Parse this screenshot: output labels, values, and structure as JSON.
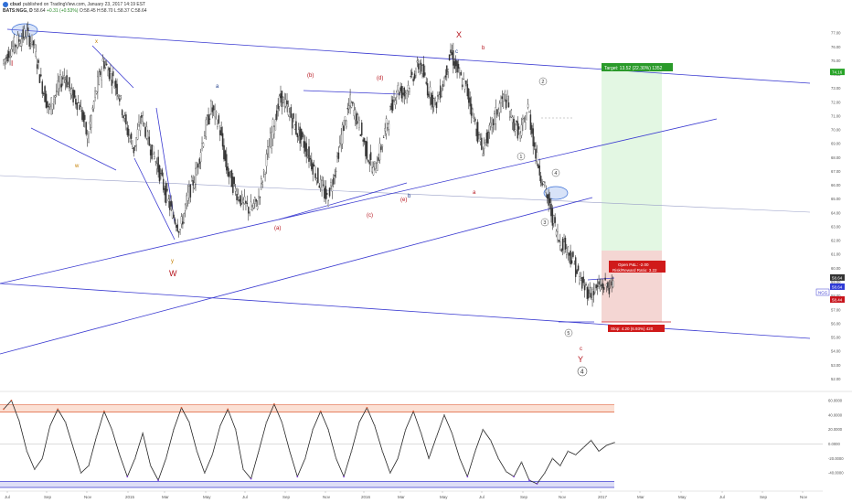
{
  "header": {
    "author": "cbud",
    "published": "published on TradingView.com, January 23, 2017 14:19 EST",
    "symbol": "BATS:NGG, D",
    "open": "58.64",
    "change": "+0.31 (+0.53%)",
    "ohlc_rest": "O:58.45 H:58.70 L:58.37 C:58.64"
  },
  "colors": {
    "candle": "#333333",
    "channel": "#3b3bd1",
    "wave_red": "#b5121b",
    "wave_orange": "#c47f00",
    "wave_blue": "#1f3d8a",
    "target_zone": "#d4f2d4",
    "stop_zone": "#f8d0d0",
    "osc_line": "#222222",
    "osc_upper_band": "#e0603a",
    "osc_lower_band": "#3b3bd1"
  },
  "chart_data": [
    {
      "type": "line",
      "title": "",
      "xlabel": "",
      "ylabel": "",
      "x_ticks": [
        "Jul",
        "Sep",
        "Nov",
        "2015",
        "Mar",
        "May",
        "Jul",
        "Sep",
        "Nov",
        "2016",
        "Mar",
        "May",
        "Jul",
        "Sep",
        "Nov",
        "2017",
        "Mar",
        "May",
        "Jul",
        "Sep",
        "Nov"
      ],
      "y_ticks": [
        "77.00",
        "76.00",
        "75.00",
        "74.00",
        "73.00",
        "72.00",
        "71.00",
        "70.00",
        "69.00",
        "68.00",
        "67.00",
        "66.00",
        "65.00",
        "64.00",
        "63.00",
        "62.00",
        "61.00",
        "60.00",
        "59.00",
        "58.00",
        "57.00",
        "56.00",
        "55.00",
        "54.00",
        "53.00",
        "52.00"
      ],
      "ylim": [
        51.5,
        78
      ],
      "series": [
        {
          "values": [
            [
              0,
              74.8
            ],
            [
              1,
              75.8
            ],
            [
              2,
              76.4
            ],
            [
              3,
              77.0
            ],
            [
              4,
              76.2
            ],
            [
              5,
              73.5
            ],
            [
              6,
              71.4
            ],
            [
              7,
              72.8
            ],
            [
              8,
              74.0
            ],
            [
              9,
              72.5
            ],
            [
              10,
              71.8
            ],
            [
              11,
              69.4
            ],
            [
              12,
              72.5
            ],
            [
              13,
              75.0
            ],
            [
              14,
              74.0
            ],
            [
              15,
              72.8
            ],
            [
              16,
              70.2
            ],
            [
              17,
              68.6
            ],
            [
              18,
              71.0
            ],
            [
              19,
              69.0
            ],
            [
              20,
              67.5
            ],
            [
              21,
              65.6
            ],
            [
              22,
              63.9
            ],
            [
              23,
              62.8
            ],
            [
              24,
              65.2
            ],
            [
              25,
              66.8
            ],
            [
              26,
              69.5
            ],
            [
              27,
              71.6
            ],
            [
              28,
              70.4
            ],
            [
              29,
              67.2
            ],
            [
              30,
              65.8
            ],
            [
              31,
              64.8
            ],
            [
              32,
              64.2
            ],
            [
              33,
              64.8
            ],
            [
              34,
              67.4
            ],
            [
              35,
              70.2
            ],
            [
              36,
              72.4
            ],
            [
              37,
              71.4
            ],
            [
              38,
              70.0
            ],
            [
              39,
              69.0
            ],
            [
              40,
              67.6
            ],
            [
              41,
              66.2
            ],
            [
              42,
              65.0
            ],
            [
              43,
              67.0
            ],
            [
              44,
              70.0
            ],
            [
              45,
              72.0
            ],
            [
              46,
              70.6
            ],
            [
              47,
              68.6
            ],
            [
              48,
              67.0
            ],
            [
              49,
              68.8
            ],
            [
              50,
              71.0
            ],
            [
              51,
              73.0
            ],
            [
              52,
              72.6
            ],
            [
              53,
              73.8
            ],
            [
              54,
              74.8
            ],
            [
              55,
              73.0
            ],
            [
              56,
              71.8
            ],
            [
              57,
              73.4
            ],
            [
              58,
              75.6
            ],
            [
              59,
              74.0
            ],
            [
              60,
              73.0
            ],
            [
              61,
              70.8
            ],
            [
              62,
              68.6
            ],
            [
              63,
              69.8
            ],
            [
              64,
              71.4
            ],
            [
              65,
              72.4
            ],
            [
              66,
              70.6
            ],
            [
              67,
              69.6
            ],
            [
              68,
              71.6
            ],
            [
              69,
              68.2
            ],
            [
              70,
              66.0
            ],
            [
              71,
              64.0
            ],
            [
              72,
              62.0
            ],
            [
              73,
              61.5
            ],
            [
              74,
              60.2
            ],
            [
              75,
              58.8
            ],
            [
              76,
              58.2
            ],
            [
              77,
              58.6
            ],
            [
              78,
              58.8
            ],
            [
              79,
              58.64
            ]
          ]
        }
      ]
    },
    {
      "type": "line",
      "title": "",
      "y_ticks": [
        "60.0000",
        "40.0000",
        "20.0000",
        "0.0000",
        "-20.0000",
        "-40.0000"
      ],
      "ylim": [
        -60,
        70
      ],
      "reference_lines": [
        54,
        44,
        -52,
        -60
      ],
      "series": [
        {
          "values": [
            [
              0,
              48
            ],
            [
              1,
              60
            ],
            [
              2,
              32
            ],
            [
              3,
              -10
            ],
            [
              4,
              -35
            ],
            [
              5,
              -20
            ],
            [
              6,
              25
            ],
            [
              7,
              48
            ],
            [
              8,
              30
            ],
            [
              9,
              -5
            ],
            [
              10,
              -40
            ],
            [
              11,
              -30
            ],
            [
              12,
              10
            ],
            [
              13,
              45
            ],
            [
              14,
              20
            ],
            [
              15,
              -15
            ],
            [
              16,
              -45
            ],
            [
              17,
              -20
            ],
            [
              18,
              15
            ],
            [
              19,
              -30
            ],
            [
              20,
              -50
            ],
            [
              21,
              -20
            ],
            [
              22,
              20
            ],
            [
              23,
              50
            ],
            [
              24,
              30
            ],
            [
              25,
              -10
            ],
            [
              26,
              -40
            ],
            [
              27,
              -15
            ],
            [
              28,
              25
            ],
            [
              29,
              48
            ],
            [
              30,
              20
            ],
            [
              31,
              -35
            ],
            [
              32,
              -48
            ],
            [
              33,
              -10
            ],
            [
              34,
              30
            ],
            [
              35,
              55
            ],
            [
              36,
              30
            ],
            [
              37,
              -10
            ],
            [
              38,
              -45
            ],
            [
              39,
              -20
            ],
            [
              40,
              20
            ],
            [
              41,
              45
            ],
            [
              42,
              20
            ],
            [
              43,
              -20
            ],
            [
              44,
              -45
            ],
            [
              45,
              -10
            ],
            [
              46,
              30
            ],
            [
              47,
              50
            ],
            [
              48,
              25
            ],
            [
              49,
              -10
            ],
            [
              50,
              -40
            ],
            [
              51,
              -20
            ],
            [
              52,
              20
            ],
            [
              53,
              45
            ],
            [
              54,
              15
            ],
            [
              55,
              -20
            ],
            [
              56,
              10
            ],
            [
              57,
              40
            ],
            [
              58,
              15
            ],
            [
              59,
              -20
            ],
            [
              60,
              -45
            ],
            [
              61,
              -10
            ],
            [
              62,
              20
            ],
            [
              63,
              5
            ],
            [
              64,
              -20
            ],
            [
              65,
              -38
            ],
            [
              66,
              -45
            ],
            [
              67,
              -25
            ],
            [
              68,
              -50
            ],
            [
              69,
              -55
            ],
            [
              70,
              -40
            ],
            [
              71,
              -20
            ],
            [
              72,
              -30
            ],
            [
              73,
              -10
            ],
            [
              74,
              -15
            ],
            [
              75,
              -5
            ],
            [
              76,
              5
            ],
            [
              77,
              -10
            ],
            [
              78,
              -2
            ],
            [
              79,
              2
            ]
          ]
        }
      ]
    }
  ],
  "price_badges": [
    {
      "text": "74.16",
      "bg": "#27a327",
      "value": 74.16
    },
    {
      "text": "58.64",
      "bg": "#333333",
      "value": 58.64
    },
    {
      "text": "58.64",
      "bg": "#2f3bd6",
      "value": 58.64
    },
    {
      "text": "58.44",
      "bg": "#c8141c",
      "value": 58.44
    }
  ],
  "ngg_label": "NGG",
  "target_label": "Target: 13.52 (22.30%) 1352",
  "pnl_label": "Open P&L: -2.00",
  "rr_label": "Risk/Reward Ratio: 3.22",
  "stop_label": "Stop: 4.20 (6.93%) 420",
  "wave_labels": [
    {
      "id": "I",
      "text": "I",
      "color": "red"
    },
    {
      "id": "x-top",
      "text": "x",
      "color": "orange"
    },
    {
      "id": "w",
      "text": "w",
      "color": "orange"
    },
    {
      "id": "y",
      "text": "y",
      "color": "orange"
    },
    {
      "id": "W",
      "text": "W",
      "color": "red"
    },
    {
      "id": "a-blue",
      "text": "a",
      "color": "blue"
    },
    {
      "id": "a-paren",
      "text": "(a)",
      "color": "red"
    },
    {
      "id": "b-paren",
      "text": "(b)",
      "color": "red"
    },
    {
      "id": "c-paren",
      "text": "(c)",
      "color": "red"
    },
    {
      "id": "d-paren",
      "text": "(d)",
      "color": "red"
    },
    {
      "id": "e-paren",
      "text": "(e)",
      "color": "red"
    },
    {
      "id": "b-blue",
      "text": "b",
      "color": "blue"
    },
    {
      "id": "X",
      "text": "X",
      "color": "red"
    },
    {
      "id": "c-top",
      "text": "c",
      "color": "blue"
    },
    {
      "id": "b-red",
      "text": "b",
      "color": "red"
    },
    {
      "id": "a-red",
      "text": "a",
      "color": "red"
    },
    {
      "id": "c-red",
      "text": "c",
      "color": "red"
    },
    {
      "id": "Y",
      "text": "Y",
      "color": "red"
    }
  ],
  "circled_labels": [
    "2",
    "1",
    "4",
    "3",
    "5",
    "4"
  ]
}
